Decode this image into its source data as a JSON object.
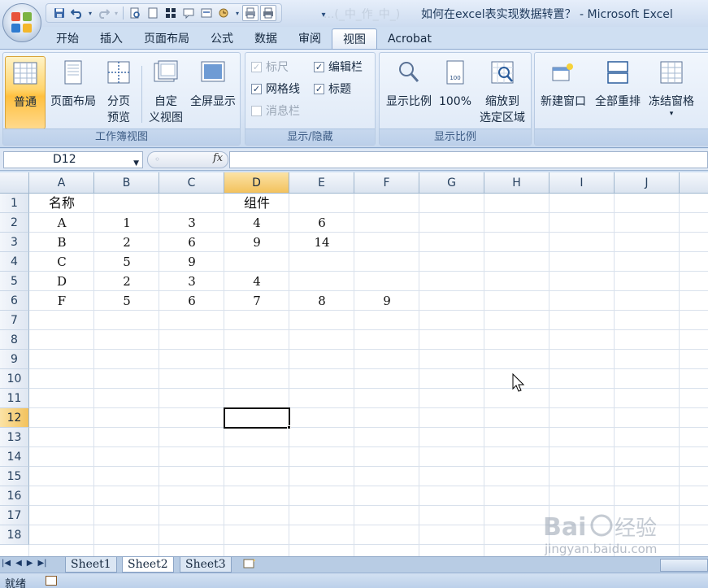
{
  "window": {
    "title": "如何在excel表实现数据转置？ - Microsoft Excel",
    "blurred_title": "...(_中_作_中_)"
  },
  "qat": {
    "icons": [
      "save-icon",
      "undo-icon",
      "redo-icon",
      "print-preview-icon",
      "new-icon",
      "table-icon",
      "comment-icon",
      "form-icon",
      "macro-icon",
      "print-icon",
      "quick-print-icon",
      "customize-icon"
    ]
  },
  "tabs": [
    "开始",
    "插入",
    "页面布局",
    "公式",
    "数据",
    "审阅",
    "视图",
    "Acrobat"
  ],
  "active_tab": "视图",
  "ribbon": {
    "workbook_views": {
      "label": "工作簿视图",
      "normal": "普通",
      "page_layout": "页面布局",
      "page_break_1": "分页",
      "page_break_2": "预览",
      "custom_1": "自定",
      "custom_2": "义视图",
      "fullscreen": "全屏显示"
    },
    "show_hide": {
      "label": "显示/隐藏",
      "ruler": "标尺",
      "formula_bar": "编辑栏",
      "gridlines": "网格线",
      "headings": "标题",
      "message_bar": "消息栏"
    },
    "zoom": {
      "label": "显示比例",
      "zoom": "显示比例",
      "hundred": "100%",
      "zoom_sel_1": "缩放到",
      "zoom_sel_2": "选定区域"
    },
    "window": {
      "new_window": "新建窗口",
      "arrange_all": "全部重排",
      "freeze_panes": "冻结窗格"
    }
  },
  "formula_bar": {
    "name_box": "D12",
    "fx": "fx",
    "formula": ""
  },
  "grid": {
    "columns": [
      "A",
      "B",
      "C",
      "D",
      "E",
      "F",
      "G",
      "H",
      "I",
      "J"
    ],
    "selected_column": "D",
    "rows": [
      "1",
      "2",
      "3",
      "4",
      "5",
      "6",
      "7",
      "8",
      "9",
      "10",
      "11",
      "12",
      "13",
      "14",
      "15",
      "16",
      "17",
      "18"
    ],
    "selected_row": "12",
    "cells": {
      "A1": "名称",
      "D1": "组件",
      "A2": "A",
      "B2": "1",
      "C2": "3",
      "D2": "4",
      "E2": "6",
      "A3": "B",
      "B3": "2",
      "C3": "6",
      "D3": "9",
      "E3": "14",
      "A4": "C",
      "B4": "5",
      "C4": "9",
      "A5": "D",
      "B5": "2",
      "C5": "3",
      "D5": "4",
      "A6": "F",
      "B6": "5",
      "C6": "6",
      "D6": "7",
      "E6": "8",
      "F6": "9"
    }
  },
  "sheets": [
    "Sheet1",
    "Sheet2",
    "Sheet3"
  ],
  "active_sheet": "Sheet2",
  "status": {
    "ready": "就绪"
  },
  "watermark": {
    "logo": "Bai度经验",
    "url": "jingyan.baidu.com"
  }
}
